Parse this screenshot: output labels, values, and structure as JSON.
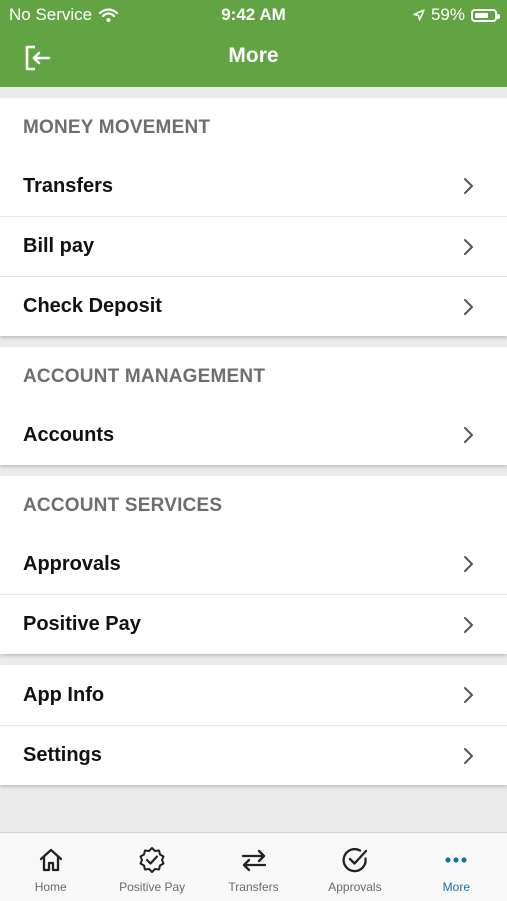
{
  "status_bar": {
    "carrier": "No Service",
    "time": "9:42 AM",
    "battery": "59%",
    "battery_level": 0.59
  },
  "header": {
    "title": "More",
    "logout_icon": "logout-icon"
  },
  "sections": {
    "money_movement": {
      "title": "MONEY MOVEMENT",
      "items": [
        "Transfers",
        "Bill pay",
        "Check Deposit"
      ]
    },
    "account_management": {
      "title": "ACCOUNT MANAGEMENT",
      "items": [
        "Accounts"
      ]
    },
    "account_services": {
      "title": "ACCOUNT SERVICES",
      "items": [
        "Approvals",
        "Positive Pay"
      ]
    },
    "other": {
      "items": [
        "App Info",
        "Settings"
      ]
    }
  },
  "tab_bar": {
    "tabs": [
      {
        "label": "Home",
        "icon": "home-icon"
      },
      {
        "label": "Positive Pay",
        "icon": "badge-check-icon"
      },
      {
        "label": "Transfers",
        "icon": "swap-arrows-icon"
      },
      {
        "label": "Approvals",
        "icon": "circle-check-icon"
      },
      {
        "label": "More",
        "icon": "more-dots-icon"
      }
    ],
    "active_index": 4
  },
  "colors": {
    "brand_green": "#62a443",
    "active_tab": "#1d6fa3",
    "section_title": "#6e6e6e"
  }
}
